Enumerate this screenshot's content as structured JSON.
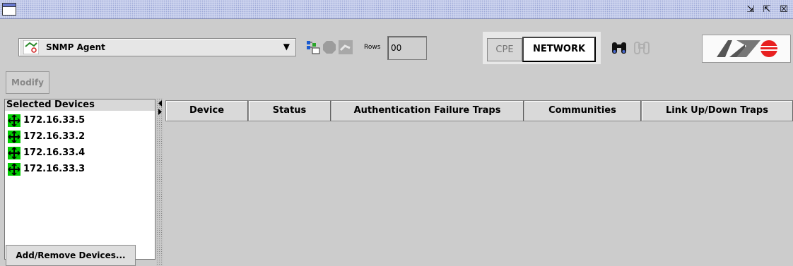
{
  "titlebar": {
    "icons": [
      "window-icon",
      "minimize-icon",
      "restore-icon",
      "close-icon"
    ],
    "minimize_glyph": "⇲",
    "restore_glyph": "⇱",
    "close_glyph": "☒"
  },
  "toolbar": {
    "agent_select": {
      "value": "SNMP Agent",
      "arrow": "▼"
    },
    "rows_label": "Rows",
    "rows_value": "00",
    "cpe_label": "CPE",
    "network_label": "NETWORK"
  },
  "actions": {
    "modify_label": "Modify"
  },
  "left_panel": {
    "header": "Selected Devices",
    "devices": [
      {
        "label": "172.16.33.5"
      },
      {
        "label": "172.16.33.2"
      },
      {
        "label": "172.16.33.4"
      },
      {
        "label": "172.16.33.3"
      }
    ],
    "add_remove_label": "Add/Remove Devices..."
  },
  "table": {
    "columns": [
      "Device",
      "Status",
      "Authentication Failure Traps",
      "Communities",
      "Link Up/Down Traps"
    ],
    "rows": []
  },
  "colors": {
    "titlebar": "#ccd3ee",
    "background": "#cccccc",
    "device_icon": "#00cc00",
    "logo_red": "#e82020"
  }
}
